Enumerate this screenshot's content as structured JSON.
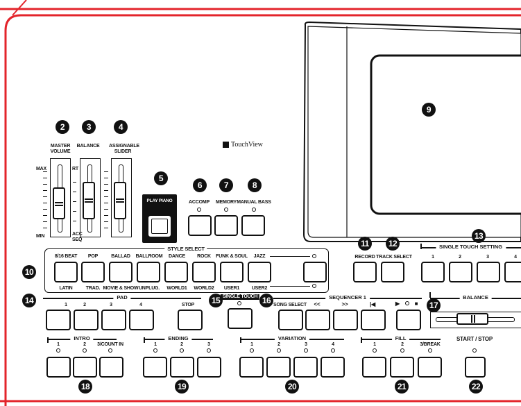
{
  "brand": {
    "logo_text": "TouchView"
  },
  "sliders": {
    "master_volume": {
      "label": "MASTER VOLUME",
      "max": "MAX",
      "min": "MIN"
    },
    "balance": {
      "label": "BALANCE",
      "top": "RT",
      "bottom": "ACC SEQ"
    },
    "assignable": {
      "label": "ASSIGNABLE SLIDER"
    }
  },
  "play_piano": {
    "label": "PLAY PIANO"
  },
  "top_buttons": {
    "accomp": "ACCOMP",
    "memory": "MEMORY",
    "manual_bass": "MANUAL BASS"
  },
  "style_select": {
    "title": "STYLE SELECT",
    "top_labels": [
      "8/16 BEAT",
      "POP",
      "BALLAD",
      "BALLROOM",
      "DANCE",
      "ROCK",
      "FUNK & SOUL",
      "JAZZ"
    ],
    "bottom_labels": [
      "LATIN",
      "TRAD.",
      "MOVIE & SHOW",
      "UNPLUG.",
      "WORLD1",
      "WORLD2",
      "USER1",
      "USER2"
    ]
  },
  "record": {
    "record": "RECORD",
    "track_select": "TRACK SELECT"
  },
  "single_touch_setting": {
    "title": "SINGLE TOUCH SETTING",
    "labels": [
      "1",
      "2",
      "3",
      "4"
    ]
  },
  "pad": {
    "title": "PAD",
    "labels": [
      "1",
      "2",
      "3",
      "4"
    ],
    "stop": "STOP"
  },
  "single_touch": {
    "label": "SINGLE TOUCH"
  },
  "sequencer": {
    "title": "SEQUENCER 1",
    "song_select": "SONG SELECT",
    "rew": "<<",
    "ff": ">>",
    "home": "|◀",
    "play": "▶",
    "stop": "■"
  },
  "balance_ctrl": {
    "title": "BALANCE"
  },
  "intro": {
    "title": "INTRO",
    "labels": [
      "1",
      "2",
      "3/COUNT IN"
    ]
  },
  "ending": {
    "title": "ENDING",
    "labels": [
      "1",
      "2",
      "3"
    ]
  },
  "variation": {
    "title": "VARIATION",
    "labels": [
      "1",
      "2",
      "3",
      "4"
    ]
  },
  "fill": {
    "title": "FILL",
    "labels": [
      "1",
      "2",
      "3/BREAK"
    ]
  },
  "start_stop": {
    "label": "START / STOP"
  },
  "callouts": {
    "n2": "2",
    "n3": "3",
    "n4": "4",
    "n5": "5",
    "n6": "6",
    "n7": "7",
    "n8": "8",
    "n9": "9",
    "n10": "10",
    "n11": "11",
    "n12": "12",
    "n13": "13",
    "n14": "14",
    "n15": "15",
    "n16": "16",
    "n17": "17",
    "n18": "18",
    "n19": "19",
    "n20": "20",
    "n21": "21",
    "n22": "22"
  },
  "colors": {
    "frame_red": "#e3242b",
    "ink": "#111111",
    "screen_gray": "#d0d0d0"
  }
}
